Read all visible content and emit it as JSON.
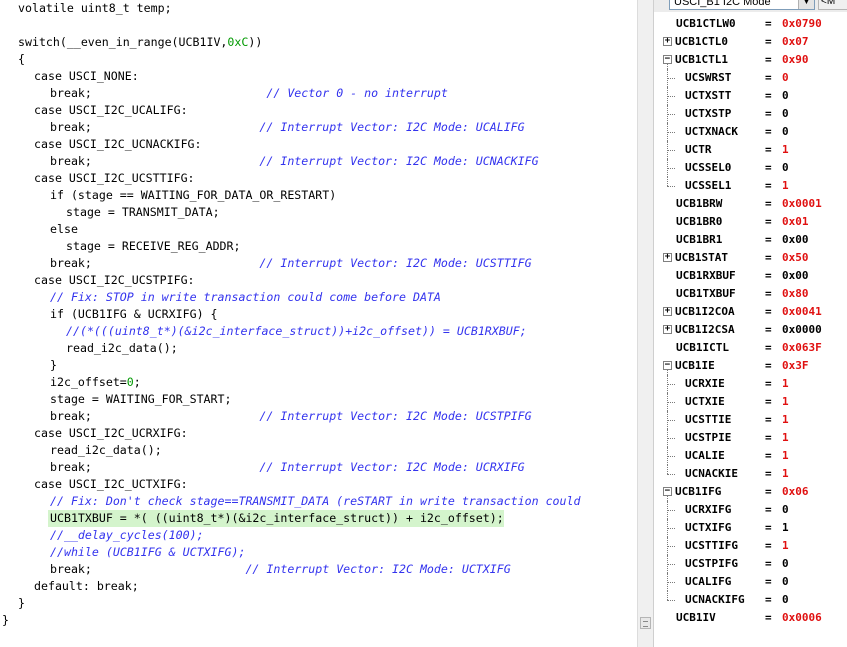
{
  "editor": {
    "lines": [
      {
        "indent": 2,
        "parts": [
          {
            "t": "volatile uint8_t temp;"
          }
        ]
      },
      {
        "indent": 0,
        "parts": []
      },
      {
        "indent": 2,
        "parts": [
          {
            "t": "switch(__even_in_range(UCB1IV,"
          },
          {
            "t": "0xC",
            "c": "num"
          },
          {
            "t": "))"
          }
        ]
      },
      {
        "indent": 2,
        "parts": [
          {
            "t": "{"
          }
        ]
      },
      {
        "indent": 4,
        "parts": [
          {
            "t": "case USCI_NONE:"
          }
        ]
      },
      {
        "indent": 6,
        "parts": [
          {
            "t": "break;                         "
          },
          {
            "t": "// Vector 0 - no interrupt",
            "c": "cmt"
          }
        ]
      },
      {
        "indent": 4,
        "parts": [
          {
            "t": "case USCI_I2C_UCALIFG:"
          }
        ]
      },
      {
        "indent": 6,
        "parts": [
          {
            "t": "break;                        "
          },
          {
            "t": "// Interrupt Vector: I2C Mode: UCALIFG",
            "c": "cmt"
          }
        ]
      },
      {
        "indent": 4,
        "parts": [
          {
            "t": "case USCI_I2C_UCNACKIFG:"
          }
        ]
      },
      {
        "indent": 6,
        "parts": [
          {
            "t": "break;                        "
          },
          {
            "t": "// Interrupt Vector: I2C Mode: UCNACKIFG",
            "c": "cmt"
          }
        ]
      },
      {
        "indent": 4,
        "parts": [
          {
            "t": "case USCI_I2C_UCSTTIFG:"
          }
        ]
      },
      {
        "indent": 6,
        "parts": [
          {
            "t": "if (stage == WAITING_FOR_DATA_OR_RESTART)"
          }
        ]
      },
      {
        "indent": 8,
        "parts": [
          {
            "t": "stage = TRANSMIT_DATA;"
          }
        ]
      },
      {
        "indent": 6,
        "parts": [
          {
            "t": "else"
          }
        ]
      },
      {
        "indent": 8,
        "parts": [
          {
            "t": "stage = RECEIVE_REG_ADDR;"
          }
        ]
      },
      {
        "indent": 6,
        "parts": [
          {
            "t": "break;                        "
          },
          {
            "t": "// Interrupt Vector: I2C Mode: UCSTTIFG",
            "c": "cmt"
          }
        ]
      },
      {
        "indent": 4,
        "parts": [
          {
            "t": "case USCI_I2C_UCSTPIFG:"
          }
        ]
      },
      {
        "indent": 6,
        "parts": [
          {
            "t": "// Fix: STOP in write transaction could come before DATA",
            "c": "cmt"
          }
        ]
      },
      {
        "indent": 6,
        "parts": [
          {
            "t": "if (UCB1IFG & UCRXIFG) {"
          }
        ]
      },
      {
        "indent": 8,
        "parts": [
          {
            "t": "//(*(((uint8_t*)(&i2c_interface_struct))+i2c_offset)) = UCB1RXBUF;",
            "c": "cmt"
          }
        ]
      },
      {
        "indent": 8,
        "parts": [
          {
            "t": "read_i2c_data();"
          }
        ]
      },
      {
        "indent": 6,
        "parts": [
          {
            "t": "}"
          }
        ]
      },
      {
        "indent": 6,
        "parts": [
          {
            "t": "i2c_offset="
          },
          {
            "t": "0",
            "c": "num"
          },
          {
            "t": ";"
          }
        ]
      },
      {
        "indent": 6,
        "parts": [
          {
            "t": "stage = WAITING_FOR_START;"
          }
        ]
      },
      {
        "indent": 6,
        "parts": [
          {
            "t": "break;                        "
          },
          {
            "t": "// Interrupt Vector: I2C Mode: UCSTPIFG",
            "c": "cmt"
          }
        ]
      },
      {
        "indent": 4,
        "parts": [
          {
            "t": "case USCI_I2C_UCRXIFG:"
          }
        ]
      },
      {
        "indent": 6,
        "parts": [
          {
            "t": "read_i2c_data();"
          }
        ]
      },
      {
        "indent": 6,
        "parts": [
          {
            "t": "break;                        "
          },
          {
            "t": "// Interrupt Vector: I2C Mode: UCRXIFG",
            "c": "cmt"
          }
        ]
      },
      {
        "indent": 4,
        "parts": [
          {
            "t": "case USCI_I2C_UCTXIFG:"
          }
        ]
      },
      {
        "indent": 6,
        "parts": [
          {
            "t": "// Fix: Don't check stage==TRANSMIT_DATA (reSTART in write transaction could",
            "c": "cmt"
          }
        ]
      },
      {
        "indent": 6,
        "hl": true,
        "parts": [
          {
            "t": "UCB1TXBUF = *( ((uint8_t*)(&i2c_interface_struct)) + i2c_offset);"
          }
        ]
      },
      {
        "indent": 6,
        "parts": [
          {
            "t": "//__delay_cycles(100);",
            "c": "cmt"
          }
        ]
      },
      {
        "indent": 6,
        "parts": [
          {
            "t": "//while (UCB1IFG & UCTXIFG);",
            "c": "cmt"
          }
        ]
      },
      {
        "indent": 6,
        "parts": [
          {
            "t": "break;                      "
          },
          {
            "t": "// Interrupt Vector: I2C Mode: UCTXIFG",
            "c": "cmt"
          }
        ]
      },
      {
        "indent": 4,
        "parts": [
          {
            "t": "default: break;"
          }
        ]
      },
      {
        "indent": 2,
        "parts": [
          {
            "t": "}"
          }
        ]
      },
      {
        "indent": 0,
        "parts": [
          {
            "t": "}"
          }
        ]
      }
    ]
  },
  "registers": {
    "dropdown_label": "USCI_B1 I2C Mode",
    "extra_button_label": "<M",
    "rows": [
      {
        "name": "UCB1CTLW0",
        "value": "0x0790",
        "changed": true
      },
      {
        "name": "UCB1CTL0",
        "value": "0x07",
        "changed": true,
        "toggle": "+"
      },
      {
        "name": "UCB1CTL1",
        "value": "0x90",
        "changed": true,
        "toggle": "-"
      },
      {
        "name": "UCSWRST",
        "value": "0",
        "changed": true,
        "child": true
      },
      {
        "name": "UCTXSTT",
        "value": "0",
        "changed": false,
        "child": true
      },
      {
        "name": "UCTXSTP",
        "value": "0",
        "changed": false,
        "child": true
      },
      {
        "name": "UCTXNACK",
        "value": "0",
        "changed": false,
        "child": true
      },
      {
        "name": "UCTR",
        "value": "1",
        "changed": true,
        "child": true
      },
      {
        "name": "UCSSEL0",
        "value": "0",
        "changed": false,
        "child": true
      },
      {
        "name": "UCSSEL1",
        "value": "1",
        "changed": true,
        "child": true,
        "last": true
      },
      {
        "name": "UCB1BRW",
        "value": "0x0001",
        "changed": true
      },
      {
        "name": "UCB1BR0",
        "value": "0x01",
        "changed": true
      },
      {
        "name": "UCB1BR1",
        "value": "0x00",
        "changed": false
      },
      {
        "name": "UCB1STAT",
        "value": "0x50",
        "changed": true,
        "toggle": "+"
      },
      {
        "name": "UCB1RXBUF",
        "value": "0x00",
        "changed": false
      },
      {
        "name": "UCB1TXBUF",
        "value": "0x80",
        "changed": true
      },
      {
        "name": "UCB1I2COA",
        "value": "0x0041",
        "changed": true,
        "toggle": "+"
      },
      {
        "name": "UCB1I2CSA",
        "value": "0x0000",
        "changed": false,
        "toggle": "+"
      },
      {
        "name": "UCB1ICTL",
        "value": "0x063F",
        "changed": true
      },
      {
        "name": "UCB1IE",
        "value": "0x3F",
        "changed": true,
        "toggle": "-"
      },
      {
        "name": "UCRXIE",
        "value": "1",
        "changed": true,
        "child": true
      },
      {
        "name": "UCTXIE",
        "value": "1",
        "changed": true,
        "child": true
      },
      {
        "name": "UCSTTIE",
        "value": "1",
        "changed": true,
        "child": true
      },
      {
        "name": "UCSTPIE",
        "value": "1",
        "changed": true,
        "child": true
      },
      {
        "name": "UCALIE",
        "value": "1",
        "changed": true,
        "child": true
      },
      {
        "name": "UCNACKIE",
        "value": "1",
        "changed": true,
        "child": true,
        "last": true
      },
      {
        "name": "UCB1IFG",
        "value": "0x06",
        "changed": true,
        "toggle": "-"
      },
      {
        "name": "UCRXIFG",
        "value": "0",
        "changed": false,
        "child": true
      },
      {
        "name": "UCTXIFG",
        "value": "1",
        "changed": false,
        "child": true
      },
      {
        "name": "UCSTTIFG",
        "value": "1",
        "changed": true,
        "child": true
      },
      {
        "name": "UCSTPIFG",
        "value": "0",
        "changed": false,
        "child": true
      },
      {
        "name": "UCALIFG",
        "value": "0",
        "changed": false,
        "child": true
      },
      {
        "name": "UCNACKIFG",
        "value": "0",
        "changed": false,
        "child": true,
        "last": true
      },
      {
        "name": "UCB1IV",
        "value": "0x0006",
        "changed": true
      }
    ]
  }
}
